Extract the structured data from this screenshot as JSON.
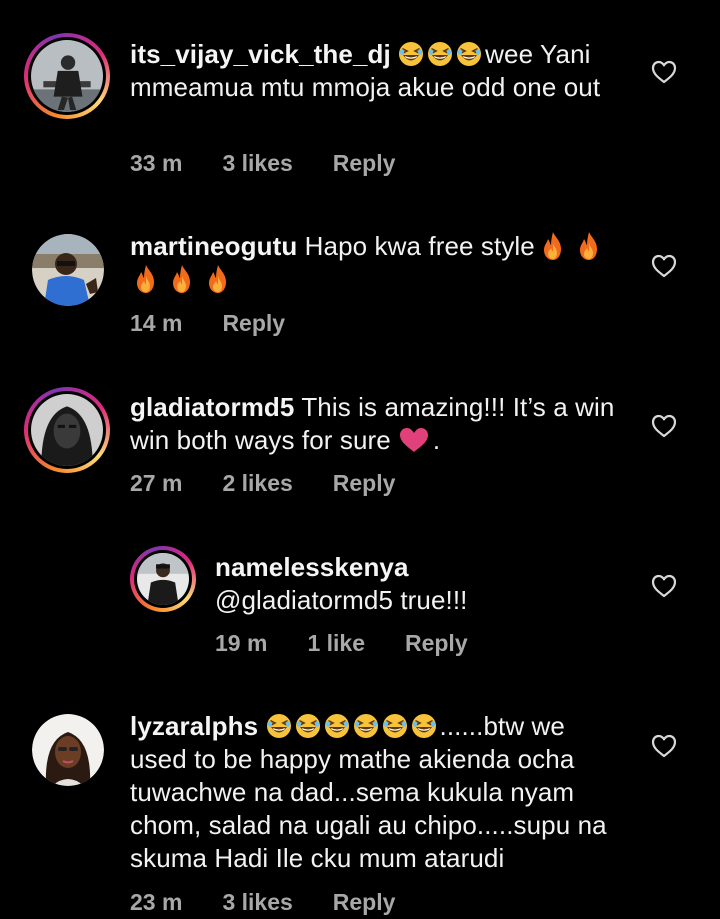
{
  "comments": [
    {
      "username": "its_vijay_vick_the_dj",
      "text_after_emoji": "wee Yani mmeamua mtu mmoja akue odd one out",
      "time": "33 m",
      "likes": "3 likes",
      "reply": "Reply"
    },
    {
      "username": "martineogutu",
      "text": "Hapo kwa free style",
      "time": "14 m",
      "reply": "Reply"
    },
    {
      "username": "gladiatormd5",
      "text": "This is amazing!!! It’s a win win both ways for sure",
      "text_end": ".",
      "time": "27 m",
      "likes": "2 likes",
      "reply": "Reply"
    },
    {
      "username": "namelesskenya",
      "text": "@gladiatormd5 true!!!",
      "time": "19 m",
      "likes": "1 like",
      "reply": "Reply"
    },
    {
      "username": "lyzaralphs",
      "text_after_emoji": "......btw we used to be happy mathe akienda ocha tuwachwe na dad...sema kukula nyam chom, salad na ugali au chipo.....supu na skuma Hadi Ile cku mum atarudi",
      "time": "23 m",
      "likes": "3 likes",
      "reply": "Reply"
    }
  ],
  "icons": {
    "like": "heart-outline-icon",
    "laugh": "grinning-squinting-face-emoji",
    "fire": "fire-emoji",
    "love": "pink-heart-emoji"
  },
  "colors": {
    "background": "#000000",
    "text": "#f5f5f5",
    "meta": "#a8a8a8",
    "story_ring": "#dd2a7b"
  }
}
